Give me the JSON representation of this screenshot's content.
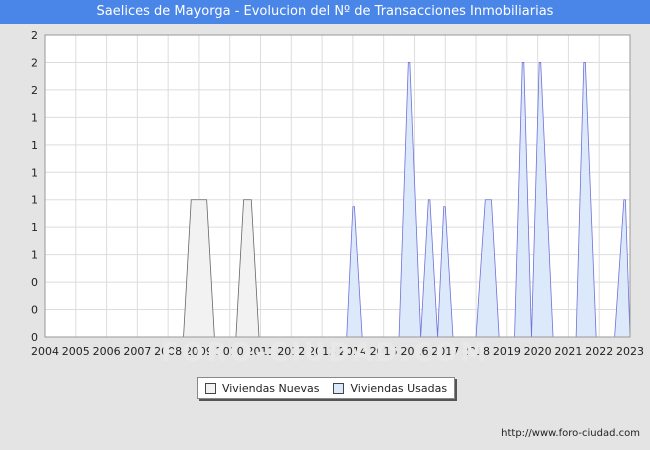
{
  "header": {
    "title": "Saelices de Mayorga - Evolucion del Nº de Transacciones Inmobiliarias"
  },
  "footer": {
    "url": "http://www.foro-ciudad.com"
  },
  "watermark": {
    "text": "FORO-CIUDAD.COM"
  },
  "chart_data": {
    "type": "area",
    "title": "Saelices de Mayorga - Evolucion del Nº de Transacciones Inmobiliarias",
    "xlabel": "",
    "ylabel": "",
    "x_ticks": [
      "2004",
      "2005",
      "2006",
      "2007",
      "2008",
      "2009",
      "2010",
      "2011",
      "2012",
      "2013",
      "2014",
      "2015",
      "2016",
      "2017",
      "2018",
      "2019",
      "2020",
      "2021",
      "2022",
      "2023"
    ],
    "y_ticks": [
      "0",
      "0",
      "0",
      "1",
      "1",
      "1",
      "1",
      "1",
      "1",
      "2",
      "2",
      "2"
    ],
    "y_tick_values": [
      0,
      0.2,
      0.4,
      0.6,
      0.8,
      1.0,
      1.2,
      1.4,
      1.6,
      1.8,
      2.0,
      2.2
    ],
    "xlim": [
      2004,
      2023
    ],
    "ylim": [
      0,
      2.2
    ],
    "grid": true,
    "legend_position": "bottom",
    "series": [
      {
        "name": "Viviendas Nuevas",
        "color": "#f2f2f2",
        "stroke": "#666666",
        "peaks": [
          {
            "start": 2008.5,
            "top_start": 2008.75,
            "top_end": 2009.25,
            "end": 2009.5,
            "value": 1
          },
          {
            "start": 2010.2,
            "top_start": 2010.45,
            "top_end": 2010.7,
            "end": 2010.95,
            "value": 1
          }
        ]
      },
      {
        "name": "Viviendas Usadas",
        "color": "#dbe9fb",
        "stroke": "#7070d8",
        "peaks": [
          {
            "start": 2013.8,
            "top_start": 2014.0,
            "top_end": 2014.05,
            "end": 2014.3,
            "value": 0.95
          },
          {
            "start": 2015.5,
            "top_start": 2015.8,
            "top_end": 2015.85,
            "end": 2016.2,
            "value": 2
          },
          {
            "start": 2016.2,
            "top_start": 2016.45,
            "top_end": 2016.5,
            "end": 2016.75,
            "value": 1
          },
          {
            "start": 2016.75,
            "top_start": 2016.95,
            "top_end": 2017.0,
            "end": 2017.25,
            "value": 0.95
          },
          {
            "start": 2018.0,
            "top_start": 2018.3,
            "top_end": 2018.5,
            "end": 2018.75,
            "value": 1
          },
          {
            "start": 2019.25,
            "top_start": 2019.5,
            "top_end": 2019.55,
            "end": 2019.8,
            "value": 2
          },
          {
            "start": 2019.8,
            "top_start": 2020.05,
            "top_end": 2020.1,
            "end": 2020.5,
            "value": 2
          },
          {
            "start": 2021.25,
            "top_start": 2021.5,
            "top_end": 2021.55,
            "end": 2021.9,
            "value": 2
          },
          {
            "start": 2022.5,
            "top_start": 2022.8,
            "top_end": 2022.85,
            "end": 2023.0,
            "value": 1
          }
        ]
      }
    ]
  }
}
